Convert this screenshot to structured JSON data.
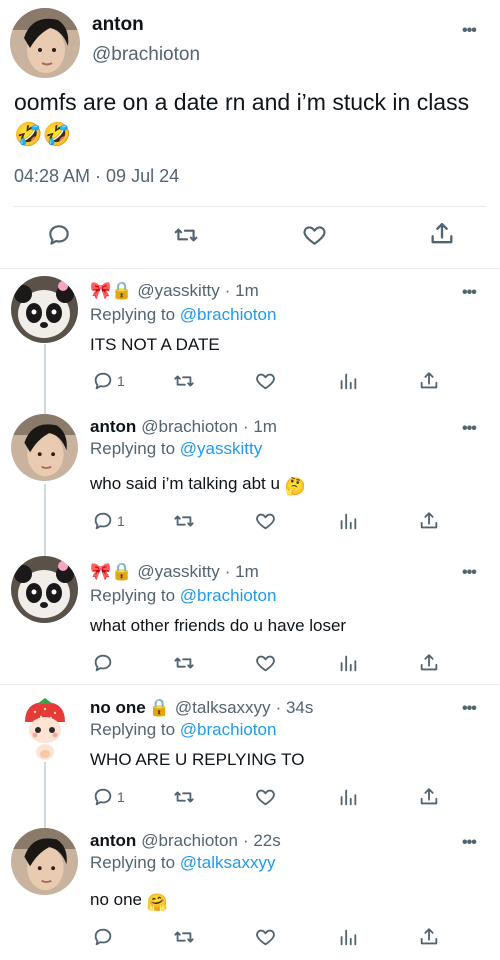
{
  "main_tweet": {
    "name": "anton",
    "handle": "@brachioton",
    "text": "oomfs are on a date rn and i’m stuck in class",
    "emoji": "🤣🤣",
    "timestamp": "04:28 AM · 09 Jul 24",
    "more": "•••"
  },
  "replies": [
    {
      "display_emoji": "🎀🔒",
      "name": "",
      "handle": "@yasskitty",
      "time": "· 1m",
      "replying_prefix": "Replying to",
      "replying_to": "@brachioton",
      "text": "ITS NOT A DATE",
      "text_emoji": "",
      "reply_count": "1",
      "avatar": "panda-avatar"
    },
    {
      "display_emoji": "",
      "name": "anton",
      "handle": "@brachioton",
      "time": "· 1m",
      "replying_prefix": "Replying to",
      "replying_to": "@yasskitty",
      "text": "who said i’m talking abt u",
      "text_emoji": "🤔",
      "reply_count": "1",
      "avatar": "anton-avatar"
    },
    {
      "display_emoji": "🎀🔒",
      "name": "",
      "handle": "@yasskitty",
      "time": "· 1m",
      "replying_prefix": "Replying to",
      "replying_to": "@brachioton",
      "text": "what other friends do u have loser",
      "text_emoji": "",
      "reply_count": "",
      "avatar": "panda-avatar"
    },
    {
      "display_emoji": "🔒",
      "name": "no one",
      "handle": "@talksaxxyy",
      "time": "· 34s",
      "replying_prefix": "Replying to",
      "replying_to": "@brachioton",
      "text": "WHO ARE U REPLYING TO",
      "text_emoji": "",
      "reply_count": "1",
      "avatar": "strawberry-doll-avatar"
    },
    {
      "display_emoji": "",
      "name": "anton",
      "handle": "@brachioton",
      "time": "· 22s",
      "replying_prefix": "Replying to",
      "replying_to": "@talksaxxyy",
      "text": "no one",
      "text_emoji": "🤗",
      "reply_count": "",
      "avatar": "anton-avatar"
    }
  ],
  "more_label": "•••",
  "colors": {
    "link": "#1d9bf0",
    "muted": "#536471",
    "text": "#0f1419",
    "border": "#e6ecf0"
  }
}
